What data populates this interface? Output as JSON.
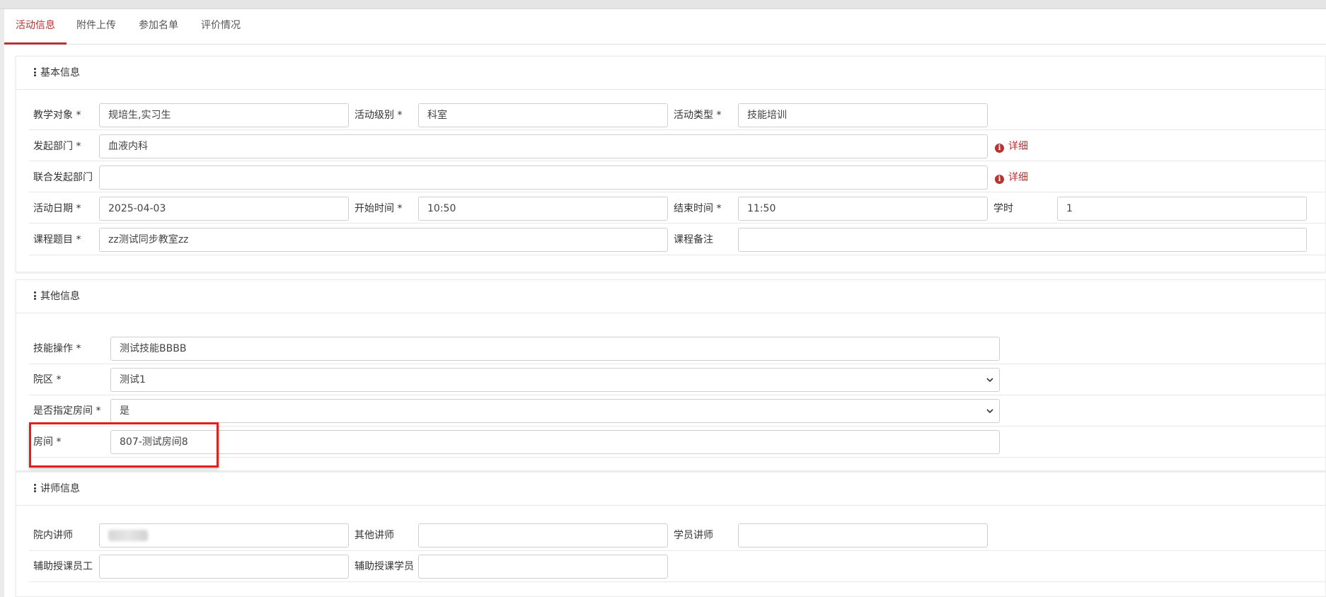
{
  "tabs": [
    "活动信息",
    "附件上传",
    "参加名单",
    "评价情况"
  ],
  "basic": {
    "title": "基本信息",
    "teaching_target_label": "教学对象 *",
    "teaching_target_value": "规培生,实习生",
    "activity_level_label": "活动级别 *",
    "activity_level_value": "科室",
    "activity_type_label": "活动类型 *",
    "activity_type_value": "技能培训",
    "initiating_dept_label": "发起部门 *",
    "initiating_dept_value": "血液内科",
    "detail_label": "详细",
    "joint_dept_label": "联合发起部门",
    "joint_dept_value": "",
    "date_label": "活动日期 *",
    "date_value": "2025-04-03",
    "start_label": "开始时间 *",
    "start_value": "10:50",
    "end_label": "结束时间 *",
    "end_value": "11:50",
    "hours_label": "学时",
    "hours_value": "1",
    "course_title_label": "课程题目 *",
    "course_title_value": "zz测试同步教室zz",
    "course_note_label": "课程备注",
    "course_note_value": ""
  },
  "other": {
    "title": "其他信息",
    "skill_label": "技能操作 *",
    "skill_value": "测试技能BBBB",
    "campus_label": "院区 *",
    "campus_value": "测试1",
    "specify_room_label": "是否指定房间 *",
    "specify_room_value": "是",
    "room_label": "房间 *",
    "room_value": "807-测试房间8"
  },
  "lecturer": {
    "title": "讲师信息",
    "internal_label": "院内讲师",
    "other_label": "其他讲师",
    "other_value": "",
    "student_label": "学员讲师",
    "student_value": "",
    "assist_staff_label": "辅助授课员工",
    "assist_staff_value": "",
    "assist_student_label": "辅助授课学员",
    "assist_student_value": ""
  },
  "colors": {
    "accent": "#b83232",
    "highlight": "#e0201e"
  }
}
